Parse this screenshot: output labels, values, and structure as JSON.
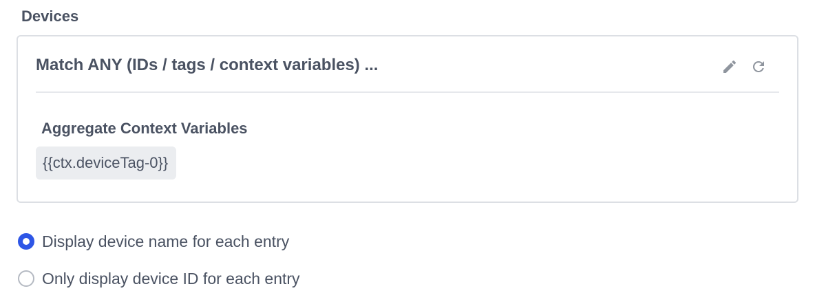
{
  "section": {
    "label": "Devices"
  },
  "card": {
    "title": "Match ANY (IDs / tags / context variables) ...",
    "edit_icon": "pencil-icon",
    "reset_icon": "refresh-icon",
    "aggregate": {
      "title": "Aggregate Context Variables",
      "tags": [
        "{{ctx.deviceTag-0}}"
      ]
    }
  },
  "options": {
    "items": [
      {
        "label": "Display device name for each entry",
        "selected": true
      },
      {
        "label": "Only display device ID for each entry",
        "selected": false
      }
    ]
  },
  "colors": {
    "accent": "#2e56e6",
    "text": "#4a5262",
    "icon": "#8f959e",
    "border": "#dcdfe4",
    "tag_bg": "#ebedf0"
  }
}
